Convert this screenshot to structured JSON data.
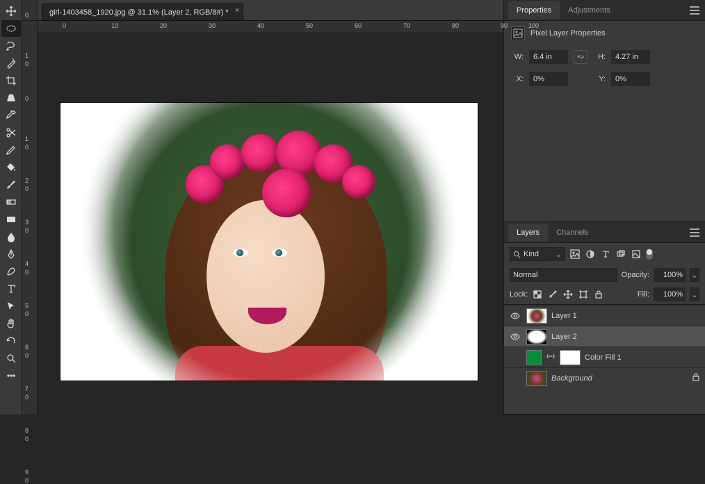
{
  "document": {
    "tab_title": "girl-1403458_1920.jpg @ 31.1% (Layer 2, RGB/8#) *"
  },
  "ruler_h": {
    "marks": [
      {
        "pos": -14,
        "label": "0"
      },
      {
        "pos": 56,
        "label": "10"
      },
      {
        "pos": 126,
        "label": "20"
      },
      {
        "pos": 196,
        "label": "30"
      },
      {
        "pos": 266,
        "label": "40"
      },
      {
        "pos": 336,
        "label": "50"
      },
      {
        "pos": 406,
        "label": "60"
      },
      {
        "pos": 476,
        "label": "70"
      },
      {
        "pos": 546,
        "label": "80"
      },
      {
        "pos": 616,
        "label": "90"
      },
      {
        "pos": 656,
        "label": "100"
      }
    ]
  },
  "ruler_v": {
    "marks": [
      {
        "pos": 6,
        "label": "0"
      },
      {
        "pos": 64,
        "label": "1"
      },
      {
        "pos": 76,
        "label": "0"
      },
      {
        "pos": 126,
        "label": "0"
      },
      {
        "pos": 184,
        "label": "1"
      },
      {
        "pos": 196,
        "label": "0"
      },
      {
        "pos": 244,
        "label": "2"
      },
      {
        "pos": 256,
        "label": "0"
      },
      {
        "pos": 304,
        "label": "3"
      },
      {
        "pos": 316,
        "label": "0"
      },
      {
        "pos": 364,
        "label": "4"
      },
      {
        "pos": 376,
        "label": "0"
      },
      {
        "pos": 424,
        "label": "5"
      },
      {
        "pos": 436,
        "label": "0"
      },
      {
        "pos": 484,
        "label": "6"
      },
      {
        "pos": 496,
        "label": "0"
      },
      {
        "pos": 544,
        "label": "7"
      },
      {
        "pos": 556,
        "label": "0"
      },
      {
        "pos": 604,
        "label": "8"
      },
      {
        "pos": 616,
        "label": "0"
      },
      {
        "pos": 664,
        "label": "9"
      },
      {
        "pos": 676,
        "label": "0"
      }
    ]
  },
  "properties": {
    "tabs": {
      "properties": "Properties",
      "adjustments": "Adjustments"
    },
    "header": "Pixel Layer Properties",
    "w_label": "W:",
    "w_value": "6.4 in",
    "h_label": "H:",
    "h_value": "4.27 in",
    "x_label": "X:",
    "x_value": "0%",
    "y_label": "Y:",
    "y_value": "0%"
  },
  "layers_panel": {
    "tabs": {
      "layers": "Layers",
      "channels": "Channels"
    },
    "filter_type": "Kind",
    "blend_mode": "Normal",
    "opacity_label": "Opacity:",
    "opacity_value": "100%",
    "lock_label": "Lock:",
    "fill_label": "Fill:",
    "fill_value": "100%",
    "layers": [
      {
        "name": "Layer 1",
        "visible": true,
        "selected": false,
        "thumb": "photo",
        "italic": false,
        "locked": false
      },
      {
        "name": "Layer 2",
        "visible": true,
        "selected": true,
        "thumb": "mask",
        "italic": false,
        "locked": false
      },
      {
        "name": "Color Fill 1",
        "visible": false,
        "selected": false,
        "thumb": "colorfill",
        "italic": false,
        "locked": false
      },
      {
        "name": "Background",
        "visible": false,
        "selected": false,
        "thumb": "photo",
        "italic": true,
        "locked": true
      }
    ]
  },
  "colors": {
    "colorfill": "#0a8a3a"
  }
}
